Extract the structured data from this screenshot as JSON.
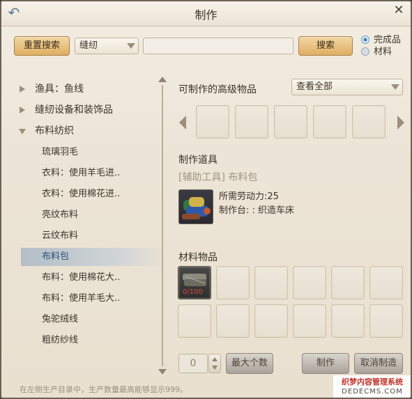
{
  "window": {
    "title": "制作"
  },
  "toolbar": {
    "reset_label": "重置搜索",
    "category_value": "缝纫",
    "search_value": "",
    "search_label": "搜索"
  },
  "filter": {
    "option_finished": "完成品",
    "option_material": "材料",
    "selected": "完成品"
  },
  "tree": {
    "categories": [
      {
        "label": "渔具：鱼线",
        "expanded": false
      },
      {
        "label": "缝纫设备和装饰品",
        "expanded": false
      },
      {
        "label": "布料纺织",
        "expanded": true
      }
    ],
    "items": [
      {
        "label": "琉璃羽毛",
        "selected": false
      },
      {
        "label": "衣料：使用羊毛进..",
        "selected": false
      },
      {
        "label": "衣料：使用棉花进..",
        "selected": false
      },
      {
        "label": "亮纹布料",
        "selected": false
      },
      {
        "label": "云纹布料",
        "selected": false
      },
      {
        "label": "布料包",
        "selected": true
      },
      {
        "label": "布料：使用棉花大..",
        "selected": false
      },
      {
        "label": "布料：使用羊毛大..",
        "selected": false
      },
      {
        "label": "兔驼绒线",
        "selected": false
      },
      {
        "label": "粗纺纱线",
        "selected": false
      }
    ]
  },
  "advanced": {
    "title": "可制作的高级物品",
    "view_select": "查看全部"
  },
  "tool": {
    "section_title": "制作道具",
    "name": "[辅助工具] 布料包",
    "labor": "所需劳动力:25",
    "station": "制作台: : 织造车床"
  },
  "materials": {
    "section_title": "材料物品",
    "first_count": "0/100"
  },
  "bottom": {
    "quantity": "0",
    "max_label": "最大个数",
    "craft_label": "制作",
    "cancel_label": "取消制造",
    "note": "在左侧生产目录中，生产数量最高能够显示999。"
  },
  "watermark": {
    "line1": "织梦内容管理系统",
    "line2": "DEDECMS.COM"
  },
  "colors": {
    "accent_orange": "#dfae62",
    "selected_blue": "#2a4f77",
    "count_red": "#d24a3a"
  },
  "icons": {
    "back": "back-arrow-icon",
    "close": "close-icon"
  }
}
